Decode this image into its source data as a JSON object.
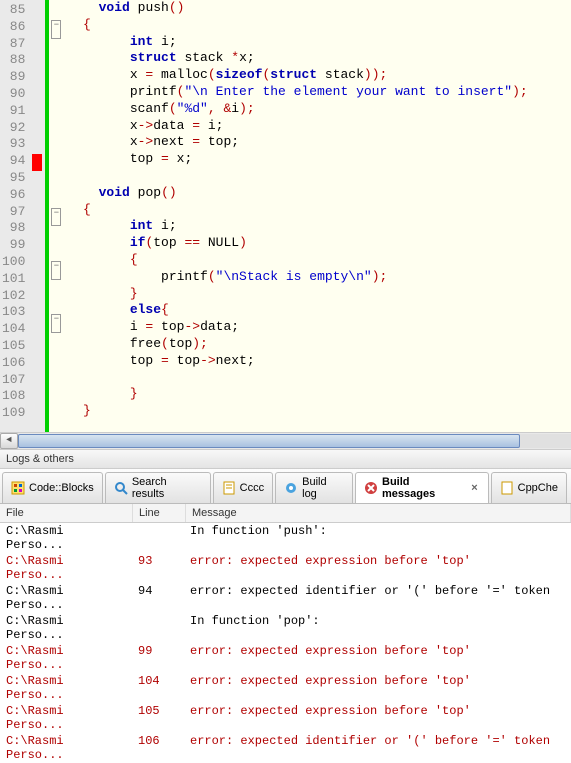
{
  "gutter": [
    "85",
    "86",
    "87",
    "88",
    "89",
    "90",
    "91",
    "92",
    "93",
    "94",
    "95",
    "96",
    "97",
    "98",
    "99",
    "100",
    "101",
    "102",
    "103",
    "104",
    "105",
    "106",
    "107",
    "108",
    "109"
  ],
  "code": {
    "l85": {
      "pre": "    ",
      "kw1": "void",
      "sp": " ",
      "fn": "push",
      "op1": "()"
    },
    "l86": {
      "pre": "  ",
      "op": "{"
    },
    "l87": {
      "pre": "        ",
      "kw": "int",
      "rest": " i;"
    },
    "l88": {
      "pre": "        ",
      "kw": "struct",
      "rest": " stack ",
      "op": "*",
      "id": "x;"
    },
    "l89": {
      "pre": "        x ",
      "op1": "=",
      "sp": " malloc",
      "op2": "(",
      "kw1": "sizeof",
      "op3": "(",
      "kw2": "struct",
      "rest": " stack",
      "op4": "));"
    },
    "l90": {
      "pre": "        printf",
      "op1": "(",
      "str": "\"\\n Enter the element your want to insert\"",
      "op2": ");"
    },
    "l91": {
      "pre": "        scanf",
      "op1": "(",
      "str": "\"%d\"",
      "op2": ", &",
      "id": "i",
      "op3": ");"
    },
    "l92": {
      "pre": "        x",
      "op1": "->",
      "id1": "data ",
      "op2": "=",
      "rest": " i;"
    },
    "l93": {
      "pre": "        x",
      "op1": "->",
      "id1": "next ",
      "op2": "=",
      "rest": " top;"
    },
    "l94": {
      "pre": "        top ",
      "op": "=",
      "rest": " x;"
    },
    "l95": {
      "pre": ""
    },
    "l96": {
      "pre": "    ",
      "kw": "void",
      "sp": " ",
      "fn": "pop",
      "op": "()"
    },
    "l97": {
      "pre": "  ",
      "op": "{"
    },
    "l98": {
      "pre": "        ",
      "kw": "int",
      "rest": " i;"
    },
    "l99": {
      "pre": "        ",
      "kw": "if",
      "op1": "(",
      "id": "top ",
      "op2": "==",
      "rest": " NULL",
      "op3": ")"
    },
    "l100": {
      "pre": "        ",
      "op": "{"
    },
    "l101": {
      "pre": "            printf",
      "op1": "(",
      "str": "\"\\nStack is empty\\n\"",
      "op2": ");"
    },
    "l102": {
      "pre": "        ",
      "op": "}"
    },
    "l103": {
      "pre": "        ",
      "kw": "else",
      "op": "{"
    },
    "l104": {
      "pre": "        i ",
      "op1": "=",
      "rest": " top",
      "op2": "->",
      "id": "data;"
    },
    "l105": {
      "pre": "        free",
      "op1": "(",
      "id": "top",
      "op2": ");"
    },
    "l106": {
      "pre": "        top ",
      "op1": "=",
      "rest": " top",
      "op2": "->",
      "id": "next;"
    },
    "l107": {
      "pre": ""
    },
    "l108": {
      "pre": "        ",
      "op": "}"
    },
    "l109": {
      "pre": "  ",
      "op": "}"
    }
  },
  "panel_title": "Logs & others",
  "tabs": {
    "codeblocks": "Code::Blocks",
    "search": "Search results",
    "cccc": "Cccc",
    "buildlog": "Build log",
    "buildmsg": "Build messages",
    "cppcheck": "CppChe"
  },
  "msg_headers": {
    "file": "File",
    "line": "Line",
    "msg": "Message"
  },
  "messages": [
    {
      "type": "info",
      "file": "C:\\Rasmi Perso...",
      "line": "",
      "msg": "In function 'push':"
    },
    {
      "type": "err",
      "file": "C:\\Rasmi Perso...",
      "line": "93",
      "msg": "error: expected expression before 'top'"
    },
    {
      "type": "info",
      "file": "C:\\Rasmi Perso...",
      "line": "94",
      "msg": "error: expected identifier or '(' before '=' token"
    },
    {
      "type": "info",
      "file": "C:\\Rasmi Perso...",
      "line": "",
      "msg": "In function 'pop':"
    },
    {
      "type": "err",
      "file": "C:\\Rasmi Perso...",
      "line": "99",
      "msg": "error: expected expression before 'top'"
    },
    {
      "type": "err",
      "file": "C:\\Rasmi Perso...",
      "line": "104",
      "msg": "error: expected expression before 'top'"
    },
    {
      "type": "err",
      "file": "C:\\Rasmi Perso...",
      "line": "105",
      "msg": "error: expected expression before 'top'"
    },
    {
      "type": "err",
      "file": "C:\\Rasmi Perso...",
      "line": "106",
      "msg": "error: expected identifier or '(' before '=' token"
    }
  ]
}
